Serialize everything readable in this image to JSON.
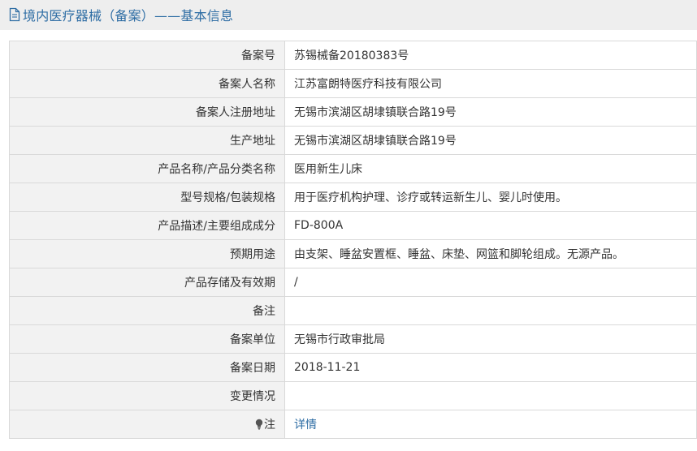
{
  "header": {
    "title": "境内医疗器械（备案）——基本信息",
    "icon": "document-icon"
  },
  "rows": [
    {
      "label": "备案号",
      "value": "苏锡械备20180383号"
    },
    {
      "label": "备案人名称",
      "value": "江苏富朗特医疗科技有限公司"
    },
    {
      "label": "备案人注册地址",
      "value": "无锡市滨湖区胡埭镇联合路19号"
    },
    {
      "label": "生产地址",
      "value": "无锡市滨湖区胡埭镇联合路19号"
    },
    {
      "label": "产品名称/产品分类名称",
      "value": "医用新生儿床"
    },
    {
      "label": "型号规格/包装规格",
      "value": "用于医疗机构护理、诊疗或转运新生儿、婴儿时使用。"
    },
    {
      "label": "产品描述/主要组成成分",
      "value": "FD-800A"
    },
    {
      "label": "预期用途",
      "value": "由支架、睡盆安置框、睡盆、床垫、网篮和脚轮组成。无源产品。"
    },
    {
      "label": "产品存储及有效期",
      "value": "/"
    },
    {
      "label": "备注",
      "value": ""
    },
    {
      "label": "备案单位",
      "value": "无锡市行政审批局"
    },
    {
      "label": "备案日期",
      "value": "2018-11-21"
    },
    {
      "label": "变更情况",
      "value": ""
    }
  ],
  "note_row": {
    "label": "注",
    "icon": "lightbulb-icon",
    "link_text": "详情"
  },
  "colors": {
    "accent": "#2e6da4",
    "label_bg": "#f2f2f2",
    "border": "#d9d9d9",
    "header_bg": "#eeeeee"
  }
}
